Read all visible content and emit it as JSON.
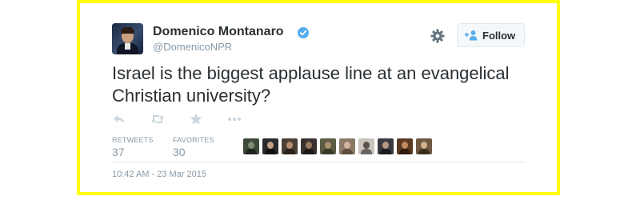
{
  "user": {
    "display_name": "Domenico Montanaro",
    "handle": "@DomenicoNPR",
    "avatar_icon": "profile-photo",
    "verified_icon": "verified-badge-icon",
    "verified_color": "#55acee"
  },
  "follow_button": {
    "label": "Follow",
    "icon": "add-person-icon",
    "icon_color": "#55acee"
  },
  "settings_icon": "gear-icon",
  "tweet": {
    "text": "Israel is the biggest applause line at an evangelical Christian university?"
  },
  "actions": [
    {
      "name": "reply",
      "icon": "reply-icon"
    },
    {
      "name": "retweet",
      "icon": "retweet-icon"
    },
    {
      "name": "favorite",
      "icon": "star-icon"
    },
    {
      "name": "more",
      "icon": "more-dots-icon"
    }
  ],
  "stats": {
    "retweets_label": "RETWEETS",
    "retweets_count": "37",
    "favorites_label": "FAVORITES",
    "favorites_count": "30"
  },
  "favorited_by_count_shown": 10,
  "timestamp": "10:42 AM - 23 Mar 2015",
  "colors": {
    "text": "#292f33",
    "muted": "#8899a6",
    "frame": "#ffff00",
    "action_icons": "#ccd6dd"
  }
}
